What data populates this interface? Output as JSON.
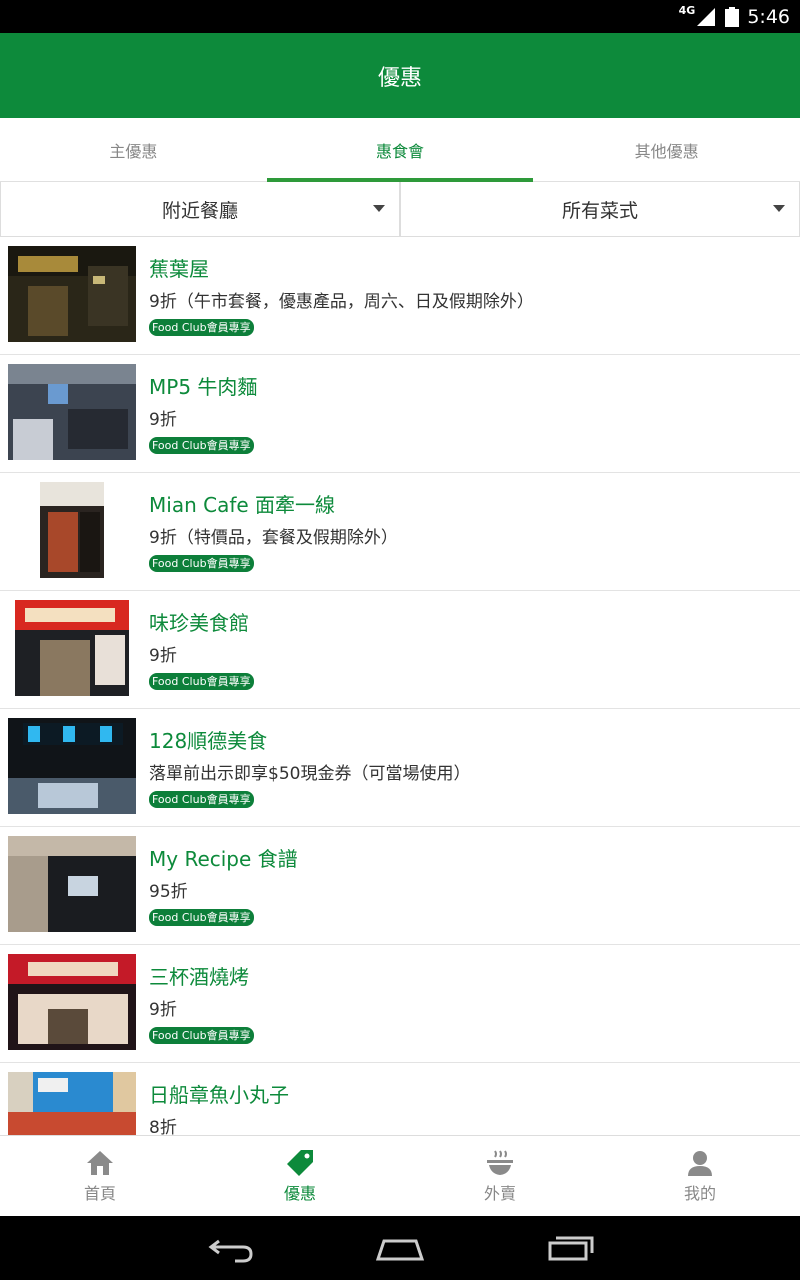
{
  "status_bar": {
    "network": "4G",
    "time": "5:46"
  },
  "app_bar": {
    "title": "優惠"
  },
  "tabs": [
    {
      "label": "主優惠",
      "active": false
    },
    {
      "label": "惠食會",
      "active": true
    },
    {
      "label": "其他優惠",
      "active": false
    }
  ],
  "filters": {
    "location": "附近餐廳",
    "cuisine": "所有菜式"
  },
  "restaurants": [
    {
      "name": "蕉葉屋",
      "offer": "9折（午市套餐，優惠產品，周六、日及假期除外）",
      "badge": "Food Club會員專享"
    },
    {
      "name": "MP5 牛肉麵",
      "offer": "9折",
      "badge": "Food Club會員專享"
    },
    {
      "name": "Mian Cafe 面牽一線",
      "offer": "9折（特價品，套餐及假期除外）",
      "badge": "Food Club會員專享"
    },
    {
      "name": "味珍美食館",
      "offer": "9折",
      "badge": "Food Club會員專享"
    },
    {
      "name": "128順德美食",
      "offer": "落單前出示即享$50現金券（可當場使用）",
      "badge": "Food Club會員專享"
    },
    {
      "name": "My Recipe 食譜",
      "offer": "95折",
      "badge": "Food Club會員專享"
    },
    {
      "name": "三杯酒燒烤",
      "offer": "9折",
      "badge": "Food Club會員專享"
    },
    {
      "name": "日船章魚小丸子",
      "offer": "8折",
      "badge": ""
    }
  ],
  "bottom_nav": [
    {
      "label": "首頁",
      "icon": "home-icon",
      "active": false
    },
    {
      "label": "優惠",
      "icon": "tag-icon",
      "active": true
    },
    {
      "label": "外賣",
      "icon": "bowl-icon",
      "active": false
    },
    {
      "label": "我的",
      "icon": "person-icon",
      "active": false
    }
  ],
  "colors": {
    "brand_green": "#0d8a3b",
    "tab_indicator": "#2e9a3a",
    "badge_green": "#0d7f3a"
  }
}
